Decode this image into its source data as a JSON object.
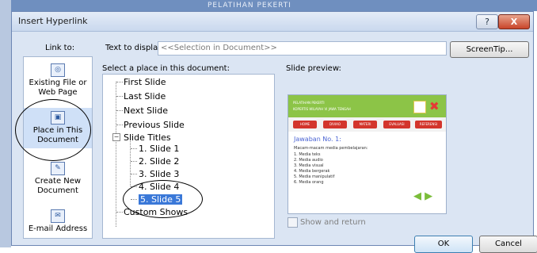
{
  "background": {
    "title": "PELATIHAN PEKERTI"
  },
  "dialog": {
    "title": "Insert Hyperlink",
    "help_label": "?",
    "close_label": "X"
  },
  "link_to": {
    "label": "Link to:",
    "items": [
      {
        "label": "Existing File or Web Page",
        "icon": "web-page-icon"
      },
      {
        "label": "Place in This Document",
        "icon": "document-place-icon",
        "selected": true
      },
      {
        "label": "Create New Document",
        "icon": "new-document-icon"
      },
      {
        "label": "E-mail Address",
        "icon": "email-icon"
      }
    ]
  },
  "text_to_display": {
    "label": "Text to display:",
    "value": "<<Selection in Document>>"
  },
  "screentip": {
    "label": "ScreenTip..."
  },
  "place": {
    "label": "Select a place in this document:",
    "items": [
      "First Slide",
      "Last Slide",
      "Next Slide",
      "Previous Slide",
      "Slide Titles",
      "1. Slide 1",
      "2. Slide 2",
      "3. Slide 3",
      "4. Slide 4",
      "5. Slide 5",
      "Custom Shows"
    ],
    "selected": "5. Slide 5"
  },
  "preview": {
    "label": "Slide preview:",
    "header_line1": "PELATIHAN PEKERTI",
    "header_line2": "KOPERTIS WILAYAH VI JAWA TENGAH",
    "buttons": [
      "HOME",
      "DIVIAO",
      "MATERI",
      "EVALUASI",
      "REFERENSI"
    ],
    "heading": "Jawaban No. 1:",
    "subheading": "Macam-macam media pembelajaran:",
    "list": [
      "1. Media teks",
      "2. Media audio",
      "3. Media visual",
      "4. Media bergerak",
      "5. Media manipulatif",
      "6. Media orang"
    ]
  },
  "show_and_return": {
    "label": "Show and return",
    "checked": false
  },
  "ok_label": "OK",
  "cancel_label": "Cancel"
}
